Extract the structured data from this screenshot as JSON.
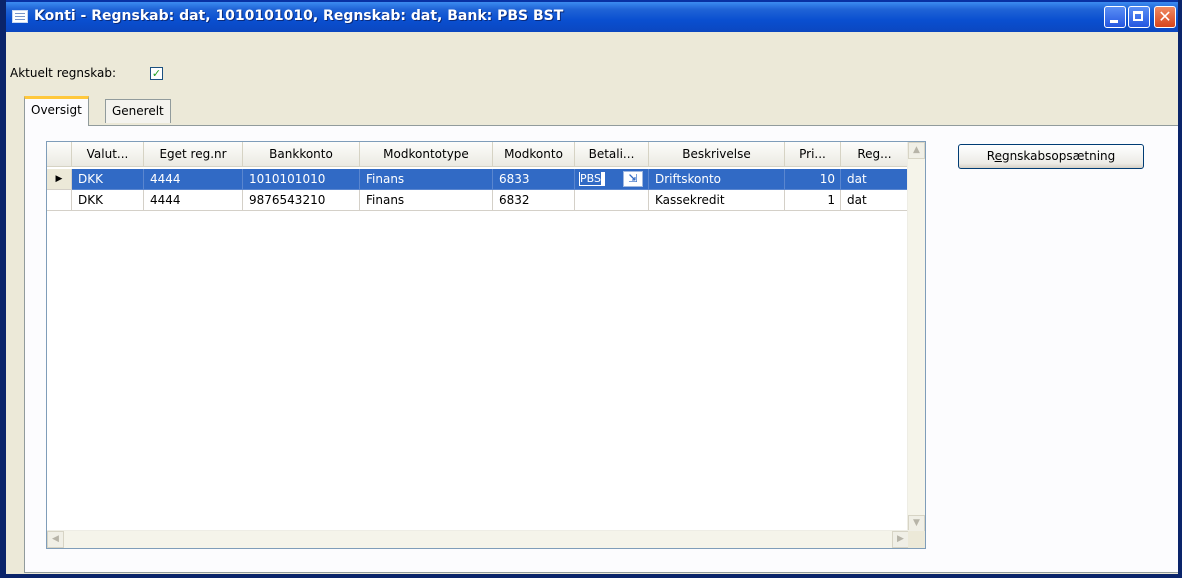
{
  "window": {
    "title": "Konti - Regnskab: dat, 1010101010, Regnskab: dat, Bank: PBS BST",
    "icon": "form-icon",
    "controls": [
      "minimize-icon",
      "maximize-icon",
      "close-icon"
    ]
  },
  "aktuelt": {
    "label": "Aktuelt regnskab:",
    "checked": true,
    "check_mark": "✓"
  },
  "tabs": [
    {
      "label": "Oversigt",
      "active": true
    },
    {
      "label": "Generelt",
      "active": false
    }
  ],
  "grid": {
    "columns": [
      "Valut...",
      "Eget reg.nr",
      "Bankkonto",
      "Modkontotype",
      "Modkonto",
      "Betali...",
      "Beskrivelse",
      "Pri...",
      "Reg..."
    ],
    "rows": [
      {
        "selected": true,
        "valuta": "DKK",
        "eget_reg_nr": "4444",
        "bankkonto": "1010101010",
        "modkontotype": "Finans",
        "modkonto": "6833",
        "betaling": "PBS",
        "beskrivelse": "Driftskonto",
        "pri": "10",
        "reg": "dat"
      },
      {
        "selected": false,
        "valuta": "DKK",
        "eget_reg_nr": "4444",
        "bankkonto": "9876543210",
        "modkontotype": "Finans",
        "modkonto": "6832",
        "betaling": "",
        "beskrivelse": "Kassekredit",
        "pri": "1",
        "reg": "dat"
      }
    ],
    "selected_row_color": "#316ac5",
    "row_indicator": "▶",
    "lookup_icon": "⇲"
  },
  "actions": {
    "regnskabsopsaetning_prefix": "R",
    "regnskabsopsaetning_mnemonic": "e",
    "regnskabsopsaetning_rest": "gnskabsopsætning"
  },
  "colors": {
    "titlebar": "#0a4fd0",
    "window_bg": "#ece9d8",
    "tab_accent": "#ffc83c"
  }
}
